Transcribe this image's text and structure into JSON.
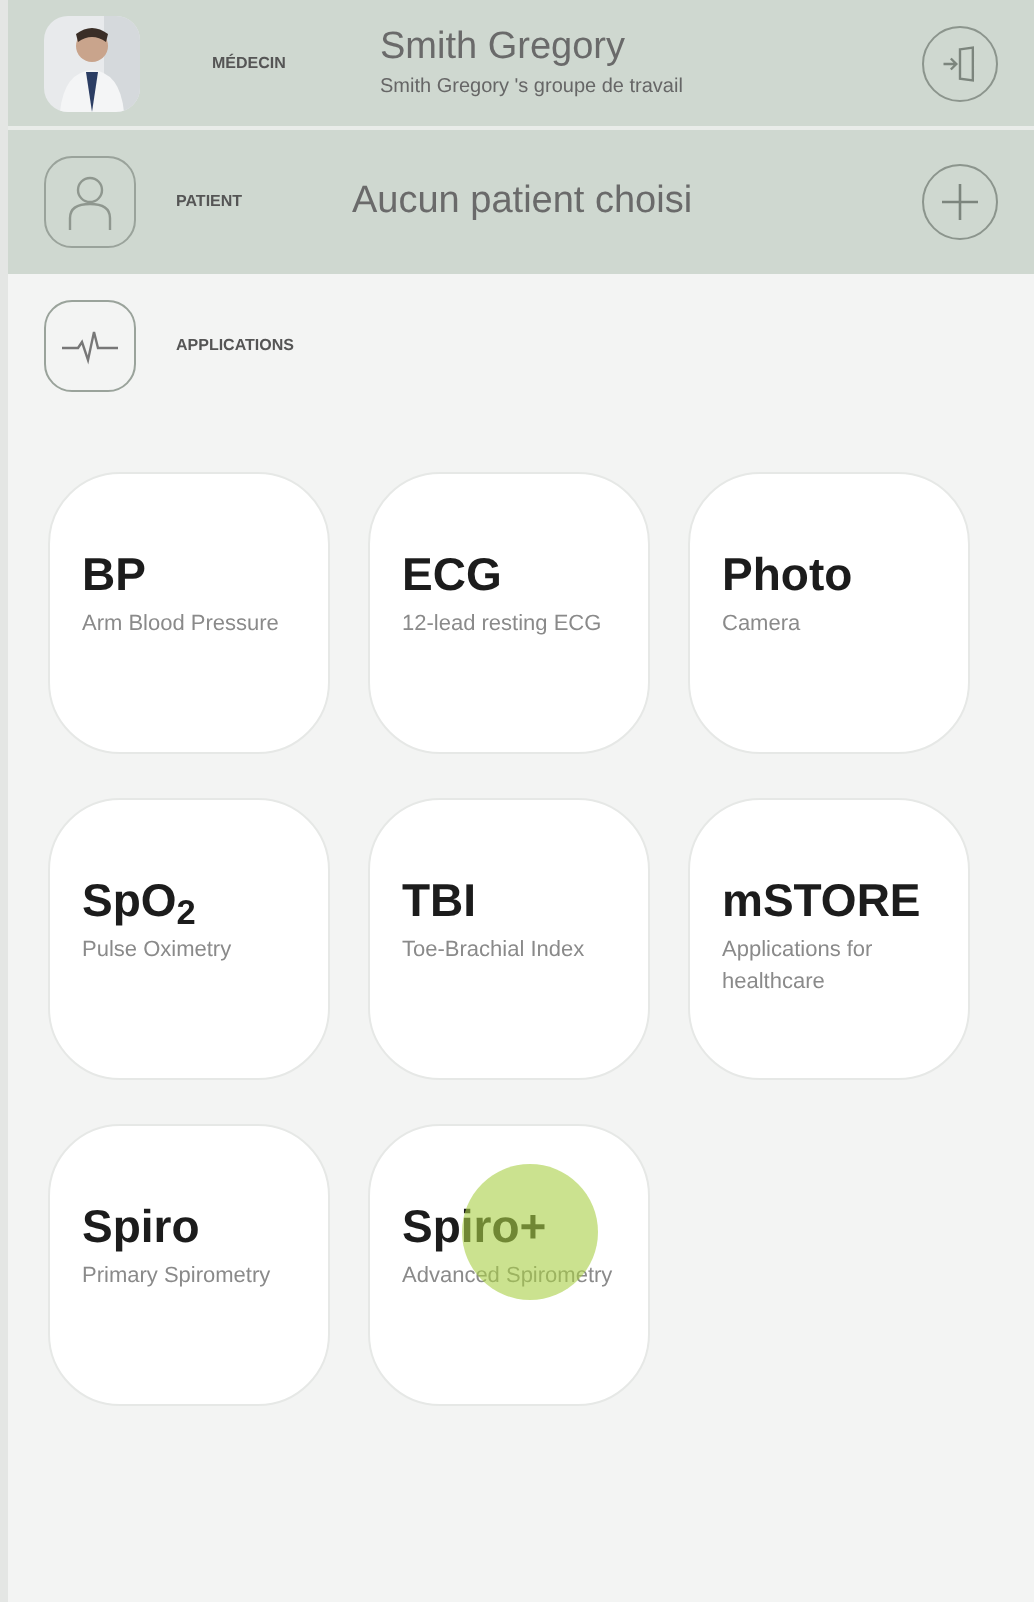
{
  "doctor": {
    "label": "MÉDECIN",
    "name": "Smith Gregory",
    "group": "Smith Gregory 's groupe de travail"
  },
  "patient": {
    "label": "PATIENT",
    "name": "Aucun patient choisi"
  },
  "applications": {
    "label": "APPLICATIONS"
  },
  "apps": [
    {
      "title": "BP",
      "subtitle": "Arm Blood Pressure",
      "pressed": false
    },
    {
      "title": "ECG",
      "subtitle": "12-lead resting ECG",
      "pressed": false
    },
    {
      "title": "Photo",
      "subtitle": "Camera",
      "pressed": false
    },
    {
      "title": "SpO$_{2}$",
      "subtitle": "Pulse Oximetry",
      "pressed": false
    },
    {
      "title": "TBI",
      "subtitle": "Toe-Brachial Index",
      "pressed": false
    },
    {
      "title": "mSTORE",
      "subtitle": "Applications for healthcare",
      "pressed": false
    },
    {
      "title": "Spiro",
      "subtitle": "Primary Spirometry",
      "pressed": false
    },
    {
      "title": "Spiro+",
      "subtitle": "Advanced Spirometry",
      "pressed": true
    }
  ]
}
